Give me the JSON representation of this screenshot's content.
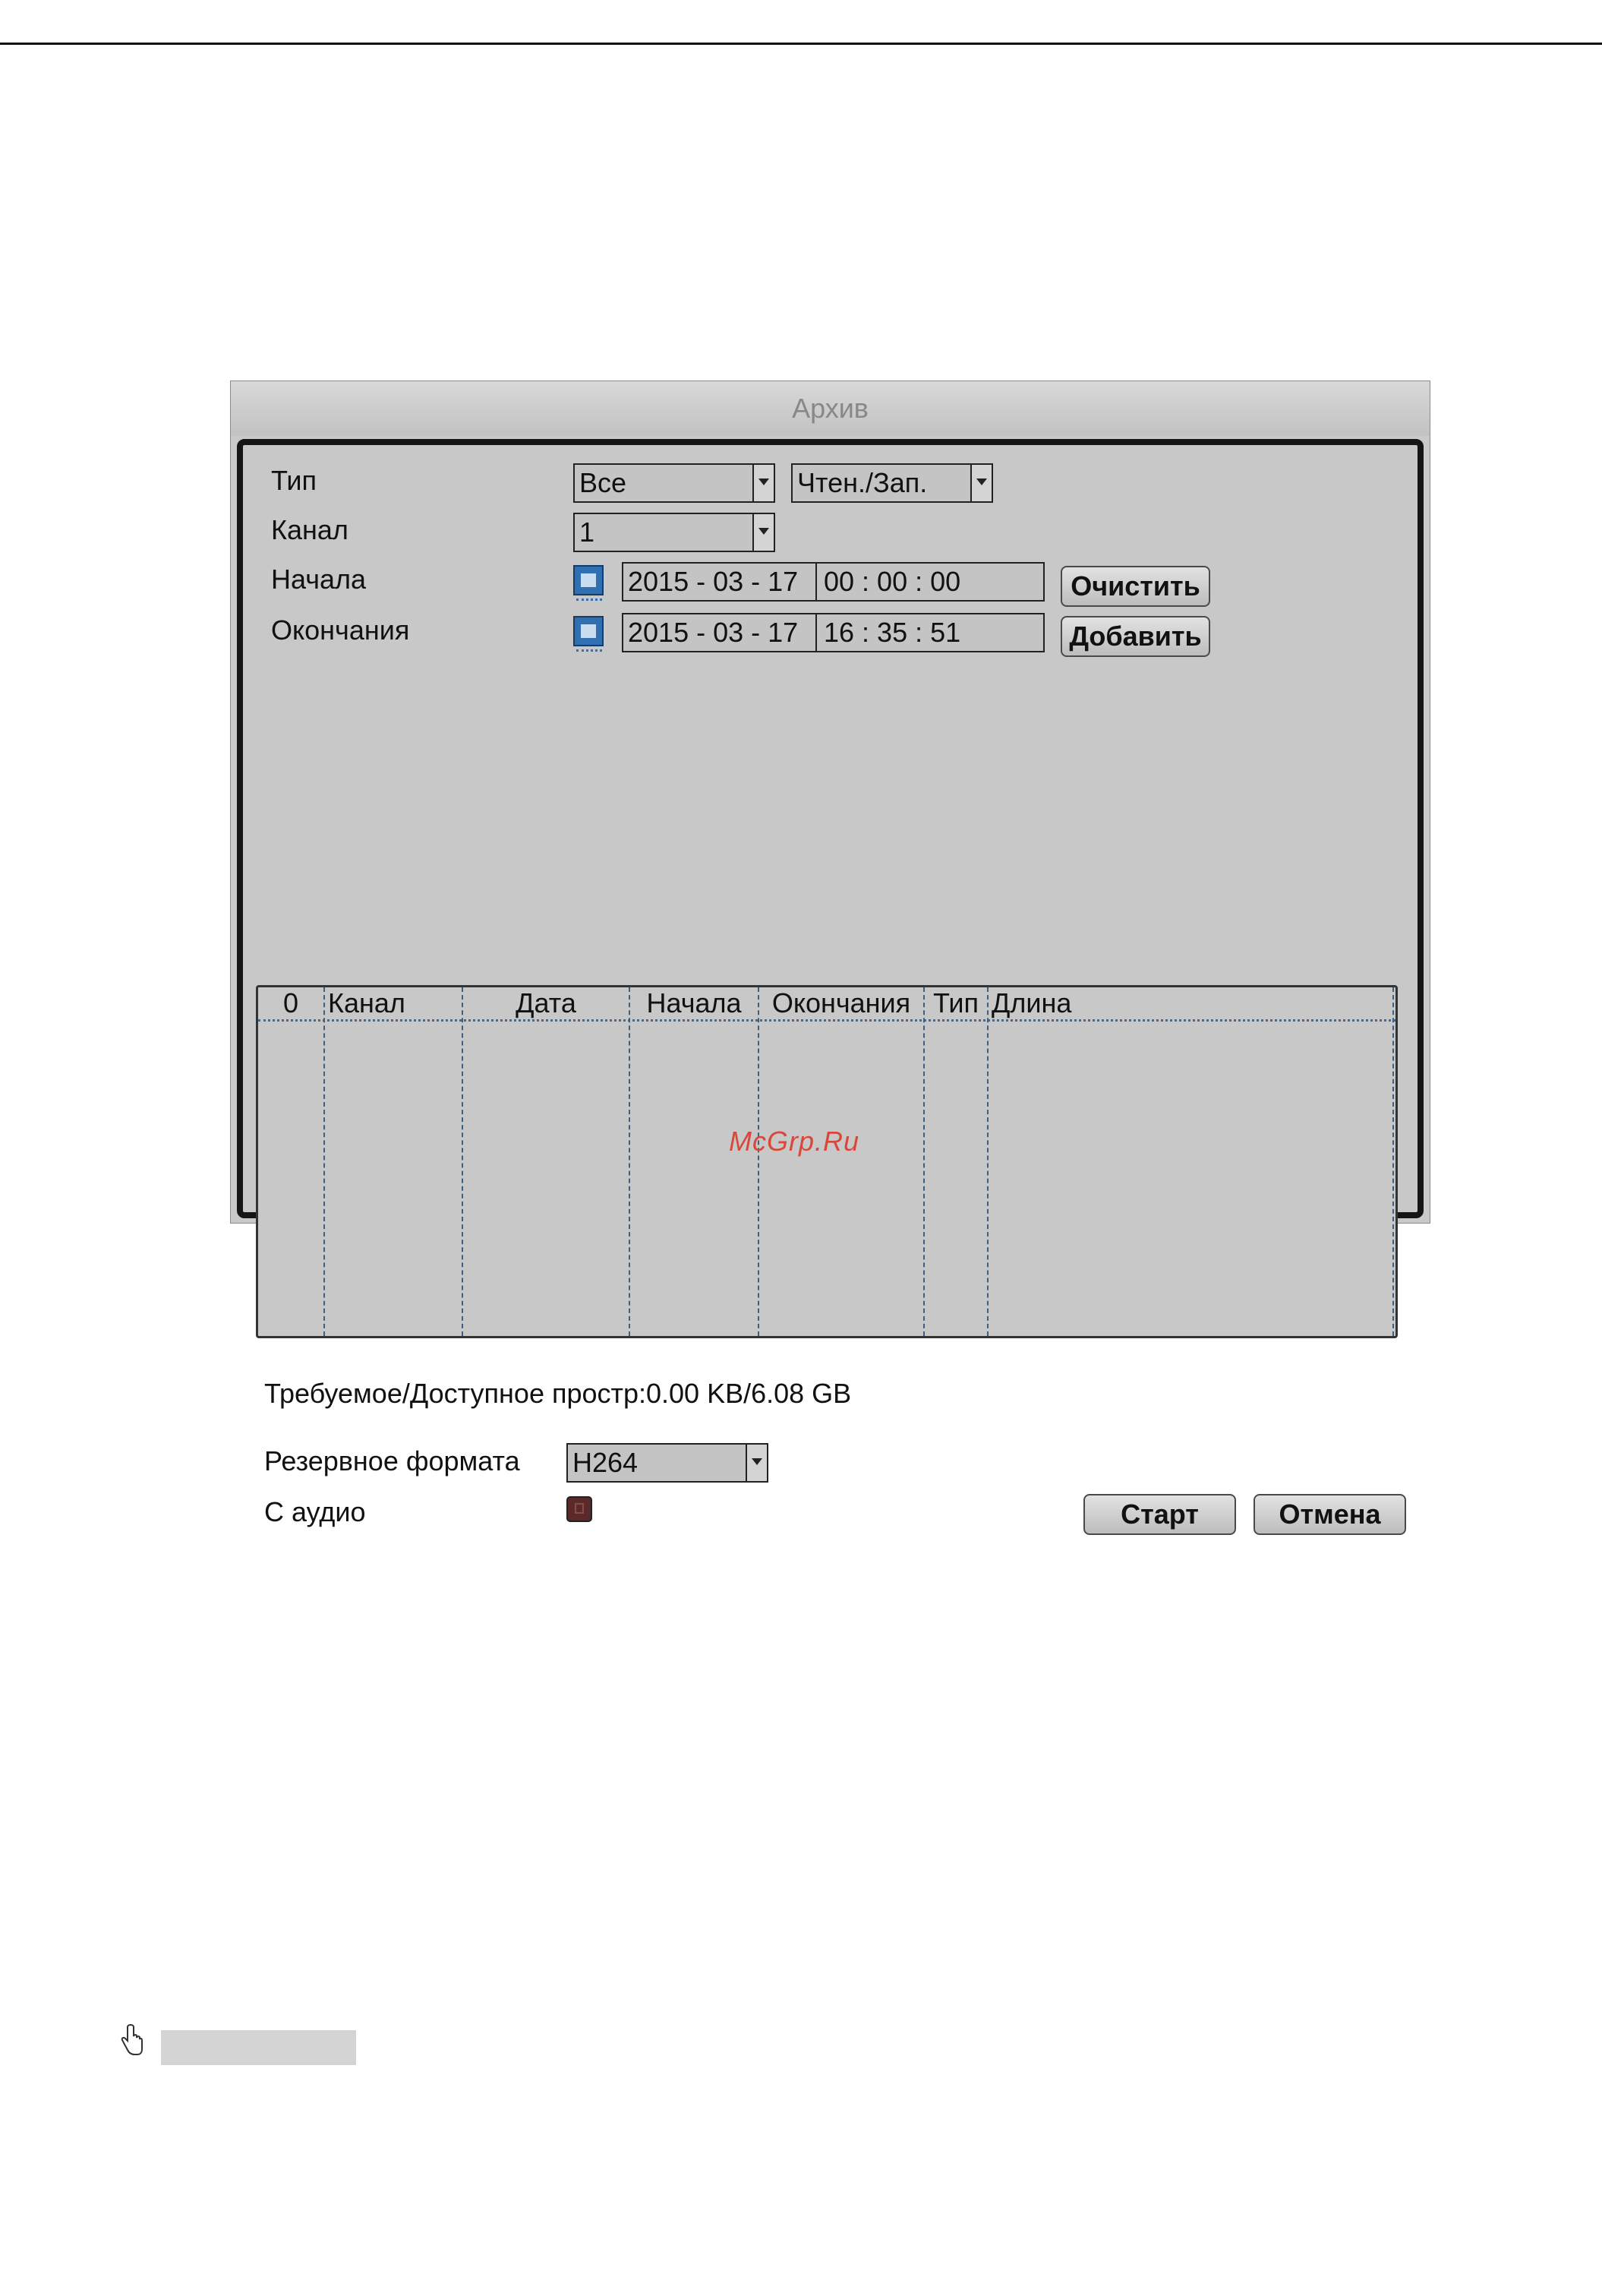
{
  "dialog": {
    "title": "Архив",
    "labels": {
      "type": "Тип",
      "channel": "Канал",
      "start": "Начала",
      "end": "Окончания",
      "backup_format": "Резервное формата",
      "with_audio": "С аудио"
    },
    "type_select": "Все",
    "mode_select": "Чтен./Зап.",
    "channel_select": "1",
    "start_date": "2015 - 03 - 17",
    "start_time": "00 : 00 : 00",
    "end_date": "2015 - 03 - 17",
    "end_time": "16 : 35 : 51",
    "clear_button": "Очистить",
    "add_button": "Добавить",
    "table_headers": [
      "0",
      "Канал",
      "Дата",
      "Начала",
      "Окончания",
      "Тип",
      "Длина"
    ],
    "space_info": "Требуемое/Доступное простр:0.00 KB/6.08 GB",
    "format_select": "H264",
    "audio_checked": true,
    "start_button": "Старт",
    "cancel_button": "Отмена"
  },
  "watermark": "McGrp.Ru"
}
